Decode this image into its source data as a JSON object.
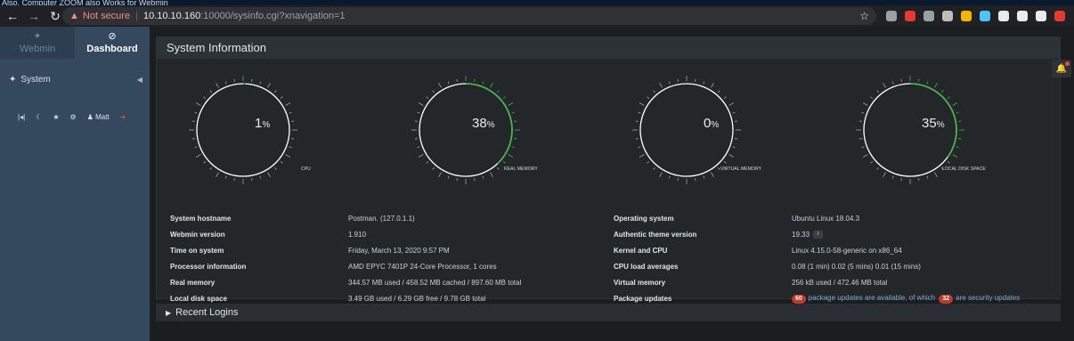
{
  "top_strip": {
    "text": "Also, Computer ZOOM also Works for Webmin"
  },
  "browser": {
    "back_icon": "arrow-left",
    "forward_icon": "arrow-right",
    "reload_icon": "reload",
    "security_label": "Not secure",
    "url_host": "10.10.10.160",
    "url_path": ":10000/sysinfo.cgi?xnavigation=1",
    "star_icon": "star",
    "extension_colors": [
      "#9aa0a6",
      "#e53935",
      "#9aa0a6",
      "#bdbdbd",
      "#f4b400",
      "#4fc3f7",
      "#e8eaed",
      "#e8eaed",
      "#e8eaed",
      "#e53935"
    ]
  },
  "sidebar": {
    "tabs": [
      {
        "label": "Webmin",
        "icon": "webmin-logo"
      },
      {
        "label": "Dashboard",
        "icon": "dashboard-gauge"
      }
    ],
    "system_label": "System",
    "user_label": "Matt"
  },
  "panel": {
    "title": "System Information"
  },
  "gauges": [
    {
      "value": "1",
      "unit": "%",
      "label": "CPU",
      "percent": 1
    },
    {
      "value": "38",
      "unit": "%",
      "label": "REAL MEMORY",
      "percent": 38
    },
    {
      "value": "0",
      "unit": "%",
      "label": "VIRTUAL MEMORY",
      "percent": 0
    },
    {
      "value": "35",
      "unit": "%",
      "label": "LOCAL DISK SPACE",
      "percent": 35
    }
  ],
  "info_left": [
    {
      "label": "System hostname",
      "value": "Postman. (127.0.1.1)"
    },
    {
      "label": "Webmin version",
      "value": "1.910"
    },
    {
      "label": "Time on system",
      "value": "Friday, March 13, 2020 9:57 PM"
    },
    {
      "label": "Processor information",
      "value": "AMD EPYC 7401P 24-Core Processor, 1 cores"
    },
    {
      "label": "Real memory",
      "value": "344.57 MB used / 458.52 MB cached / 897.60 MB total"
    },
    {
      "label": "Local disk space",
      "value": "3.49 GB used / 6.29 GB free / 9.78 GB total"
    }
  ],
  "info_right": [
    {
      "label": "Operating system",
      "value": "Ubuntu Linux 18.04.3"
    },
    {
      "label": "Authentic theme version",
      "value": "19.33"
    },
    {
      "label": "Kernel and CPU",
      "value": "Linux 4.15.0-58-generic on x86_64"
    },
    {
      "label": "CPU load averages",
      "value": "0.08 (1 min) 0.02 (5 mins) 0.01 (15 mins)"
    },
    {
      "label": "Virtual memory",
      "value": "256 kB used / 472.46 MB total"
    },
    {
      "label": "Package updates",
      "value": ""
    }
  ],
  "package_updates": {
    "count": "60",
    "text1": "package updates are available, of which",
    "security_count": "32",
    "text2": "are security updates"
  },
  "recent_logins": {
    "label": "Recent Logins"
  },
  "colors": {
    "gauge_fill": "#4caf50",
    "gauge_ring": "#ffffff",
    "badge": "#c0392b"
  }
}
